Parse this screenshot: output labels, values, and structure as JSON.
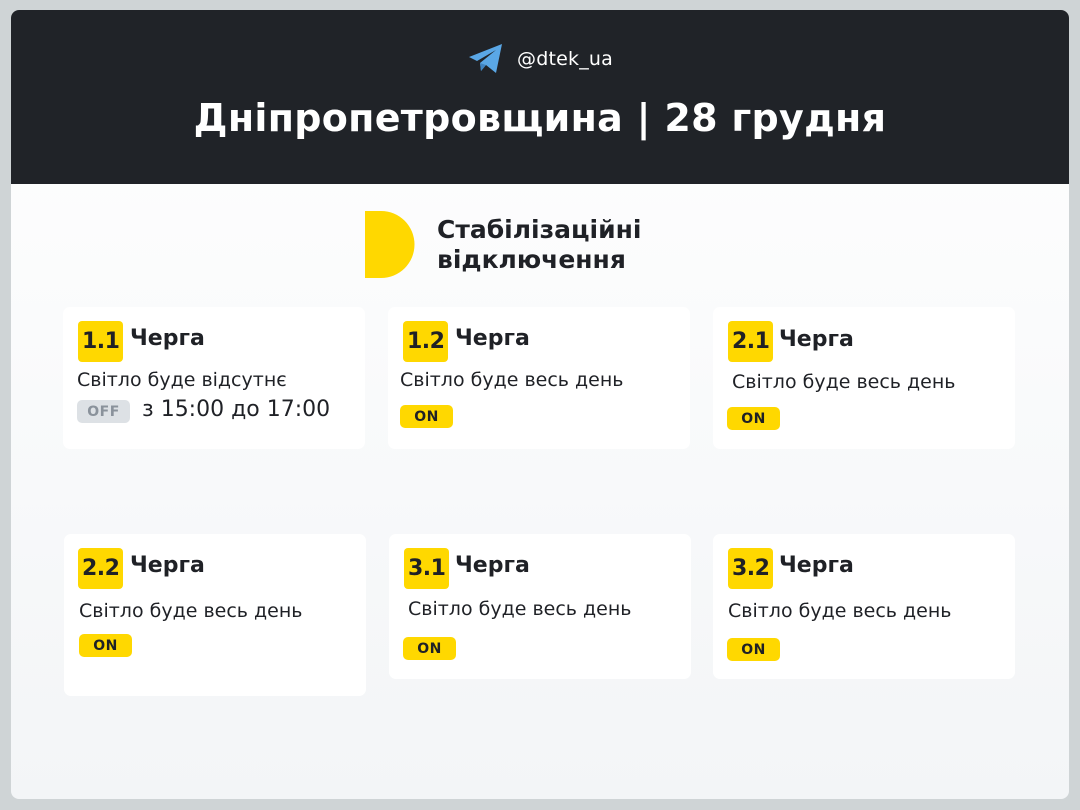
{
  "header": {
    "handle": "@dtek_ua",
    "title": "Дніпропетровщина | 28 грудня"
  },
  "subtitle": {
    "line1": "Стабілізаційні",
    "line2": "відключення"
  },
  "colors": {
    "accent": "#ffd800",
    "header_bg": "#202328",
    "telegram": "#5aa7e6",
    "off_bg": "#dde1e5"
  },
  "queues": [
    {
      "id": "1.1",
      "word": "Черга",
      "status": "Світло буде відсутнє",
      "state": "OFF",
      "time": "з 15:00 до 17:00"
    },
    {
      "id": "1.2",
      "word": "Черга",
      "status": "Світло буде весь день",
      "state": "ON"
    },
    {
      "id": "2.1",
      "word": "Черга",
      "status": "Світло буде весь день",
      "state": "ON"
    },
    {
      "id": "2.2",
      "word": "Черга",
      "status": "Світло буде весь день",
      "state": "ON"
    },
    {
      "id": "3.1",
      "word": "Черга",
      "status": "Світло буде весь день",
      "state": "ON"
    },
    {
      "id": "3.2",
      "word": "Черга",
      "status": "Світло буде весь день",
      "state": "ON"
    }
  ]
}
